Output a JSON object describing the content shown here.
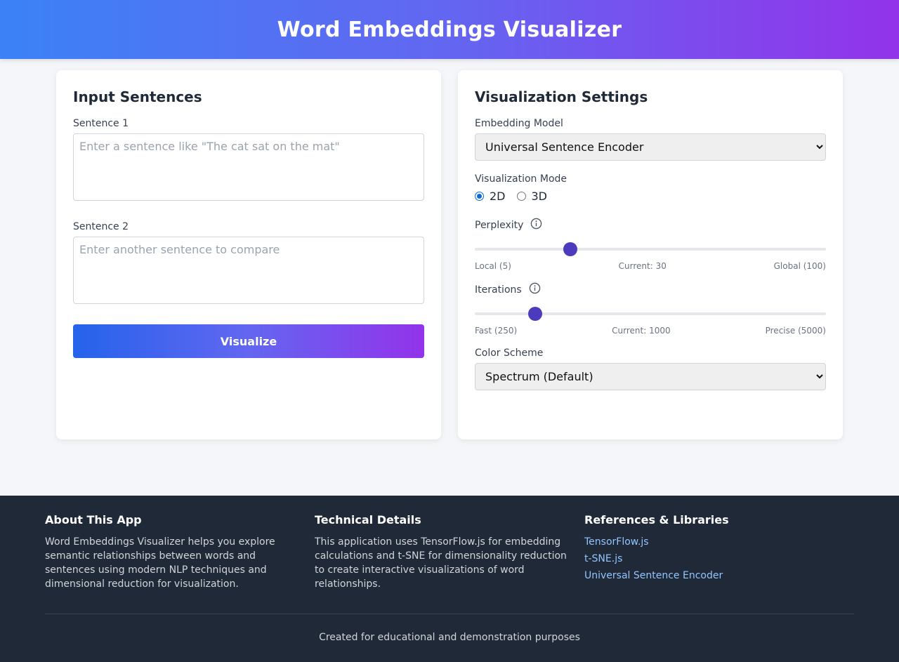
{
  "header": {
    "title": "Word Embeddings Visualizer"
  },
  "input_panel": {
    "title": "Input Sentences",
    "sentence1": {
      "label": "Sentence 1",
      "placeholder": "Enter a sentence like \"The cat sat on the mat\"",
      "value": ""
    },
    "sentence2": {
      "label": "Sentence 2",
      "placeholder": "Enter another sentence to compare",
      "value": ""
    },
    "visualize_label": "Visualize"
  },
  "settings_panel": {
    "title": "Visualization Settings",
    "model": {
      "label": "Embedding Model",
      "selected": "Universal Sentence Encoder"
    },
    "mode": {
      "label": "Visualization Mode",
      "options": [
        "2D",
        "3D"
      ],
      "selected": "2D"
    },
    "perplexity": {
      "label": "Perplexity",
      "min_label": "Local (5)",
      "current_label": "Current: 30",
      "max_label": "Global (100)",
      "min": 5,
      "max": 100,
      "value": 30
    },
    "iterations": {
      "label": "Iterations",
      "min_label": "Fast (250)",
      "current_label": "Current: 1000",
      "max_label": "Precise (5000)",
      "min": 250,
      "max": 5000,
      "value": 1000
    },
    "color_scheme": {
      "label": "Color Scheme",
      "selected": "Spectrum (Default)"
    }
  },
  "footer": {
    "about": {
      "title": "About This App",
      "text": "Word Embeddings Visualizer helps you explore semantic relationships between words and sentences using modern NLP techniques and dimensional reduction for visualization."
    },
    "technical": {
      "title": "Technical Details",
      "text": "This application uses TensorFlow.js for embedding calculations and t-SNE for dimensionality reduction to create interactive visualizations of word relationships."
    },
    "references": {
      "title": "References & Libraries",
      "links": [
        "TensorFlow.js",
        "t-SNE.js",
        "Universal Sentence Encoder"
      ]
    },
    "note": "Created for educational and demonstration purposes"
  },
  "colors": {
    "header_start": "#3b82f6",
    "header_end": "#9333ea",
    "thumb": "#4c3bbd",
    "footer_bg": "#1f2937",
    "link": "#93c5fd"
  }
}
